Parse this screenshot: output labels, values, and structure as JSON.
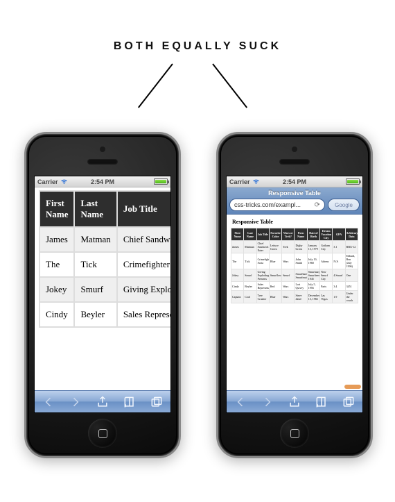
{
  "heading": "BOTH EQUALLY SUCK",
  "status": {
    "carrier": "Carrier",
    "time": "2:54 PM"
  },
  "left_phone": {
    "table": {
      "headers": [
        "First Name",
        "Last Name",
        "Job Title"
      ],
      "rows": [
        {
          "first": "James",
          "last": "Matman",
          "job": "Chief Sandwich Eater"
        },
        {
          "first": "The",
          "last": "Tick",
          "job": "Crimefighter Sorta"
        },
        {
          "first": "Jokey",
          "last": "Smurf",
          "job": "Giving Exploding Presents"
        },
        {
          "first": "Cindy",
          "last": "Beyler",
          "job": "Sales Representative"
        }
      ]
    }
  },
  "right_phone": {
    "page_title": "Responsive Table",
    "url": "css-tricks.com/exampl...",
    "search_placeholder": "Google",
    "page_heading": "Responsive Table",
    "table": {
      "headers": [
        "First Name",
        "Last Name",
        "Job Title",
        "Favorite Color",
        "Wars or Trek?",
        "Porn Name",
        "Date of Birth",
        "Dream Vacation City",
        "GPA",
        "Arbitrary Data"
      ],
      "rows": [
        [
          "James",
          "Matman",
          "Chief Sandwich Eater",
          "Lettuce Green",
          "Trek",
          "Digby Green",
          "January 13, 1979",
          "Gotham City",
          "3.1",
          "RBX-12"
        ],
        [
          "The",
          "Tick",
          "Crimefighter Sorta",
          "Blue",
          "Wars",
          "John Smith",
          "July 19, 1968",
          "Athens",
          "N/A",
          "Edlund, Ben (July 1996)"
        ],
        [
          "Jokey",
          "Smurf",
          "Giving Exploding Presents",
          "Smurflow",
          "Smurf",
          "Smurflane Smurfmutt",
          "Smurfuary Smurfteenth, 1945",
          "New Smurf City",
          "4.Smurf",
          "One"
        ],
        [
          "Cindy",
          "Beyler",
          "Sales Representative",
          "Red",
          "Wars",
          "Lori Quivey",
          "July 5, 1956",
          "Paris",
          "3.4",
          "3451"
        ],
        [
          "Captain",
          "Cool",
          "Tree Crusher",
          "Blue",
          "Wars",
          "Steve 42nd",
          "December 13, 1982",
          "Las Vegas",
          "1.9",
          "Under the couch"
        ]
      ]
    }
  }
}
